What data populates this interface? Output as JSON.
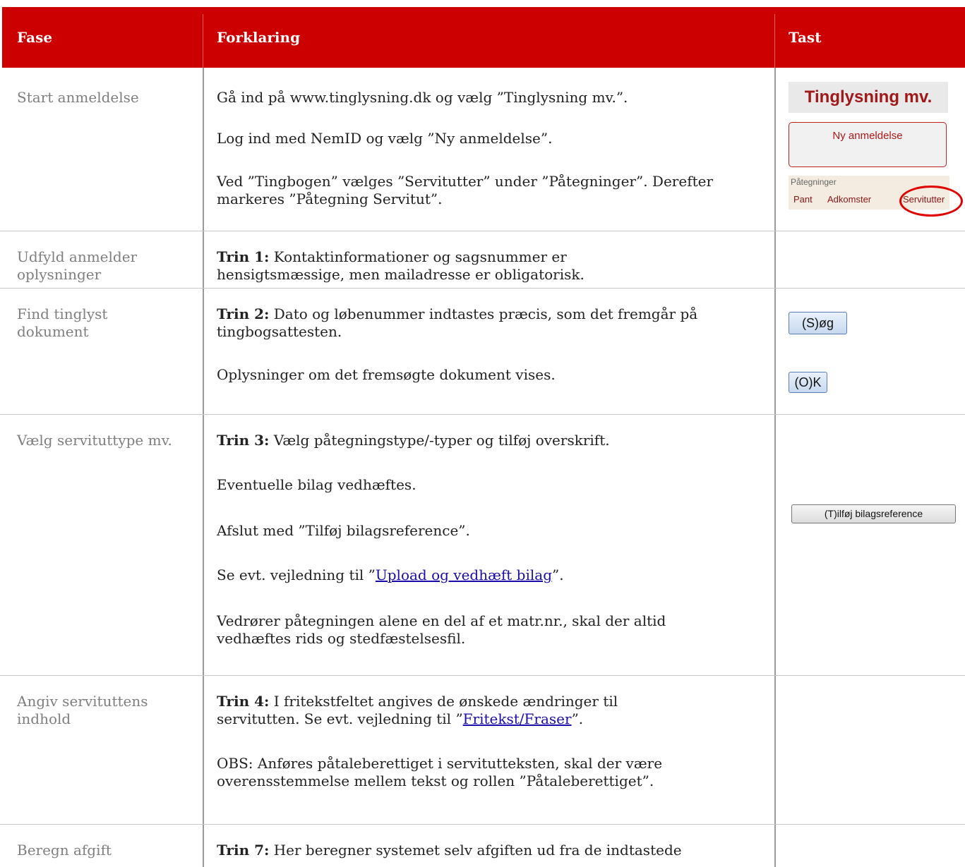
{
  "header": {
    "col1": "Fase",
    "col2": "Forklaring",
    "col3": "Tast"
  },
  "rows": [
    {
      "fase": "Start anmeldelse",
      "paragraphs": [
        "Gå ind på www.tinglysning.dk og vælg ”Tinglysning mv.”.",
        "Log ind med NemID og vælg ”Ny anmeldelse”.",
        "Ved ”Tingbogen” vælges ”Servitutter” under ”Påtegninger”. Derefter markeres ”Påtegning Servitut”."
      ],
      "tast": {
        "banner": "Tinglysning mv.",
        "button": "Ny anmeldelse",
        "pategninger_label": "Påtegninger",
        "pategninger_items": [
          "Pant",
          "Adkomster",
          "Servitutter"
        ]
      }
    },
    {
      "fase": "Udfyld anmelder oplysninger",
      "bold": "Trin 1:",
      "text": " Kontaktinformationer og sagsnummer er hensigtsmæssige, men mailadresse er obligatorisk."
    },
    {
      "fase": "Find tinglyst dokument",
      "bold": "Trin 2:",
      "text": " Dato og løbenummer indtastes præcis, som det fremgår på tingbogsattesten.",
      "p2": "Oplysninger om det fremsøgte dokument vises.",
      "tast": {
        "btn1": "(S)øg",
        "btn2": "(O)K"
      }
    },
    {
      "fase": "Vælg servituttype mv.",
      "bold": "Trin 3:",
      "text": " Vælg påtegningstype/-typer og tilføj overskrift.",
      "p2": "Eventuelle bilag vedhæftes.",
      "p3": "Afslut med ”Tilføj bilagsreference”.",
      "p4_pre": "Se evt. vejledning til ”",
      "p4_link": "Upload og vedhæft bilag",
      "p4_post": "”.",
      "p5": "Vedrører påtegningen alene en del af et matr.nr., skal der altid vedhæftes rids og stedfæstelsesfil.",
      "tast": {
        "btn": "(T)ilføj bilagsreference"
      }
    },
    {
      "fase": "Angiv servituttens indhold",
      "bold": "Trin 4:",
      "text_pre": " I fritekstfeltet angives de ønskede ændringer til servitutten. Se evt. vejledning til ”",
      "link": "Fritekst/Fraser",
      "text_post": "”.",
      "p2": "OBS: Anføres påtaleberettiget i servitutteksten, skal der være overensstemmelse mellem tekst og rollen ”Påtaleberettiget”."
    },
    {
      "fase": "Beregn afgift",
      "bold": "Trin 7:",
      "text": " Her beregner systemet selv afgiften ud fra de indtastede"
    }
  ]
}
